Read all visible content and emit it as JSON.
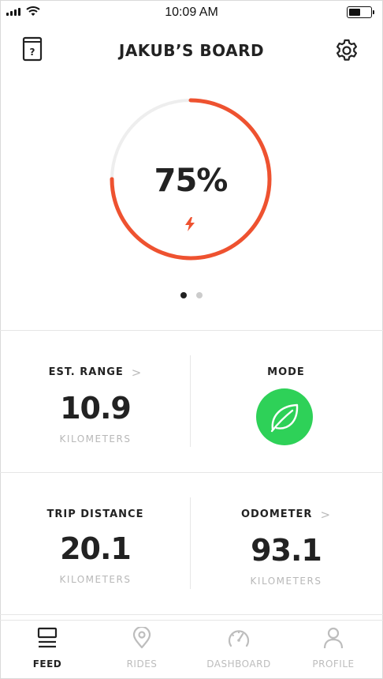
{
  "status_bar": {
    "time": "10:09 AM"
  },
  "header": {
    "title": "JAKUB’S BOARD"
  },
  "battery_gauge": {
    "percent_label": "75%",
    "charge_fraction": 0.75,
    "accent_color": "#ee5230",
    "track_color": "#eeeeee"
  },
  "pager": {
    "pages": 2,
    "active": 0
  },
  "stats": {
    "est_range": {
      "label": "EST. RANGE",
      "value": "10.9",
      "unit": "KILOMETERS"
    },
    "mode": {
      "label": "MODE",
      "icon": "leaf-icon",
      "color": "#2ed158"
    },
    "trip_distance": {
      "label": "TRIP DISTANCE",
      "value": "20.1",
      "unit": "KILOMETERS"
    },
    "odometer": {
      "label": "ODOMETER",
      "value": "93.1",
      "unit": "KILOMETERS"
    }
  },
  "tabs": [
    {
      "label": "FEED",
      "icon": "feed-icon",
      "active": true
    },
    {
      "label": "RIDES",
      "icon": "location-pin-icon",
      "active": false
    },
    {
      "label": "DASHBOARD",
      "icon": "speedometer-icon",
      "active": false
    },
    {
      "label": "PROFILE",
      "icon": "person-icon",
      "active": false
    }
  ]
}
